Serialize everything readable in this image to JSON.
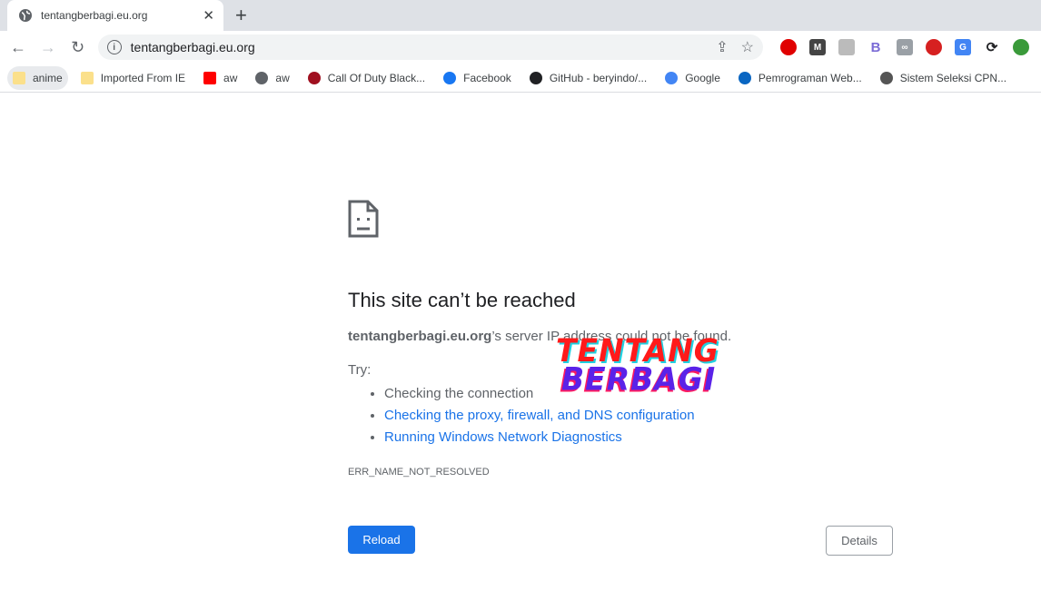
{
  "tab": {
    "title": "tentangberbagi.eu.org",
    "favicon": "globe-icon"
  },
  "omnibox": {
    "url": "tentangberbagi.eu.org"
  },
  "extensions": [
    {
      "name": "adblock",
      "color": "#e00000",
      "label": ""
    },
    {
      "name": "mega",
      "color": "#444",
      "label": "M"
    },
    {
      "name": "ext-gray",
      "color": "#bbb",
      "label": ""
    },
    {
      "name": "ext-b",
      "color": "#fff",
      "label": "B"
    },
    {
      "name": "ext-link",
      "color": "#9aa0a6",
      "label": "∞"
    },
    {
      "name": "ext-block",
      "color": "#d62020",
      "label": ""
    },
    {
      "name": "google-translate",
      "color": "#4285f4",
      "label": "G"
    },
    {
      "name": "sync",
      "color": "#fff",
      "label": "⟳"
    },
    {
      "name": "idm",
      "color": "#3a9a3a",
      "label": ""
    }
  ],
  "bookmarks": [
    {
      "label": "anime",
      "icon": "folder-icon",
      "color": "#fbe08b"
    },
    {
      "label": "Imported From IE",
      "icon": "folder-icon",
      "color": "#fbe08b"
    },
    {
      "label": "aw",
      "icon": "youtube-icon",
      "color": "#ff0000"
    },
    {
      "label": "aw",
      "icon": "globe-icon",
      "color": "#5f6368"
    },
    {
      "label": "Call Of Duty Black...",
      "icon": "gamepad-icon",
      "color": "#a01020"
    },
    {
      "label": "Facebook",
      "icon": "facebook-icon",
      "color": "#1877f2"
    },
    {
      "label": "GitHub - beryindo/...",
      "icon": "github-icon",
      "color": "#202124"
    },
    {
      "label": "Google",
      "icon": "google-icon",
      "color": "#4285f4"
    },
    {
      "label": "Pemrograman Web...",
      "icon": "linkedin-icon",
      "color": "#0a66c2"
    },
    {
      "label": "Sistem Seleksi CPN...",
      "icon": "bkn-icon",
      "color": "#555"
    }
  ],
  "error": {
    "title": "This site can’t be reached",
    "host": "tentangberbagi.eu.org",
    "message": "’s server IP address could not be found.",
    "try": "Try:",
    "suggestions": [
      "Checking the connection",
      "Checking the proxy, firewall, and DNS configuration",
      "Running Windows Network Diagnostics"
    ],
    "code": "ERR_NAME_NOT_RESOLVED",
    "reload": "Reload",
    "details": "Details"
  },
  "watermark": {
    "line1": "TENTANG",
    "line2": "BERBAGI"
  }
}
